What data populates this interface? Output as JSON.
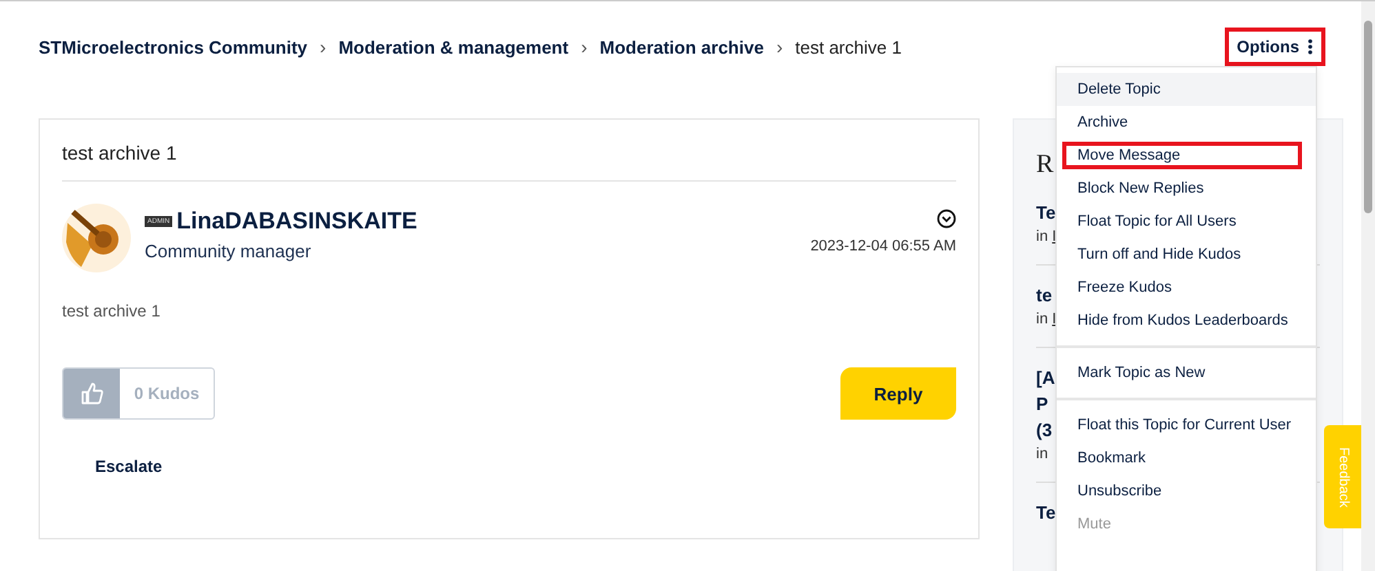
{
  "breadcrumb": [
    {
      "label": "STMicroelectronics Community",
      "current": false
    },
    {
      "label": "Moderation & management",
      "current": false
    },
    {
      "label": "Moderation archive",
      "current": false
    },
    {
      "label": "test archive 1",
      "current": true
    }
  ],
  "separator": "›",
  "options_button": {
    "label": "Options",
    "highlighted": true
  },
  "post": {
    "title": "test archive 1",
    "rank_badge": "ADMIN",
    "author": "LinaDABASINSKAITE",
    "role": "Community manager",
    "date": "2023-12-04 06:55 AM",
    "body": "test archive 1",
    "kudos": "0 Kudos",
    "reply": "Reply",
    "escalate": "Escalate"
  },
  "sidebar": {
    "heading": "R",
    "entries": [
      {
        "lines": [
          "Te"
        ],
        "in": "in",
        "link": "I"
      },
      {
        "lines": [
          "te"
        ],
        "in": "in",
        "link": "I"
      },
      {
        "lines": [
          "[A",
          "P",
          "(3"
        ],
        "in": "in"
      },
      {
        "lines": [
          "Te"
        ]
      }
    ]
  },
  "menu": {
    "groups": [
      [
        {
          "label": "Delete Topic",
          "hovered": true,
          "highlighted": false,
          "disabled": false
        },
        {
          "label": "Archive",
          "hovered": false,
          "highlighted": false,
          "disabled": false
        },
        {
          "label": "Move Message",
          "hovered": false,
          "highlighted": true,
          "disabled": false
        },
        {
          "label": "Block New Replies",
          "hovered": false,
          "highlighted": false,
          "disabled": false
        },
        {
          "label": "Float Topic for All Users",
          "hovered": false,
          "highlighted": false,
          "disabled": false
        },
        {
          "label": "Turn off and Hide Kudos",
          "hovered": false,
          "highlighted": false,
          "disabled": false
        },
        {
          "label": "Freeze Kudos",
          "hovered": false,
          "highlighted": false,
          "disabled": false
        },
        {
          "label": "Hide from Kudos Leaderboards",
          "hovered": false,
          "highlighted": false,
          "disabled": false
        }
      ],
      [
        {
          "label": "Mark Topic as New",
          "hovered": false,
          "highlighted": false,
          "disabled": false
        }
      ],
      [
        {
          "label": "Float this Topic for Current User",
          "hovered": false,
          "highlighted": false,
          "disabled": false
        },
        {
          "label": "Bookmark",
          "hovered": false,
          "highlighted": false,
          "disabled": false
        },
        {
          "label": "Unsubscribe",
          "hovered": false,
          "highlighted": false,
          "disabled": false
        },
        {
          "label": "Mute",
          "hovered": false,
          "highlighted": false,
          "disabled": true
        }
      ]
    ]
  },
  "feedback": "Feedback"
}
